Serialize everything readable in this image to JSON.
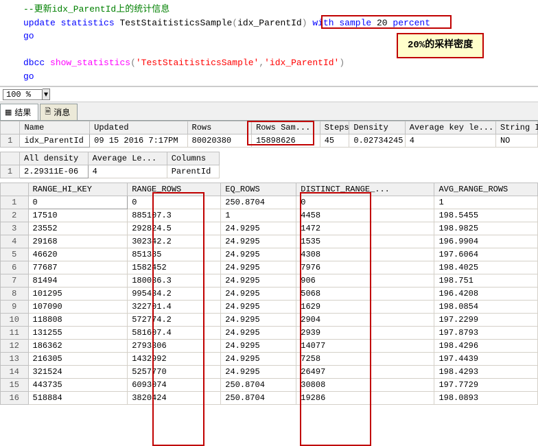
{
  "sql": {
    "comment": "--更新idx_ParentId上的统计信息",
    "update": "update",
    "statistics": "statistics",
    "tableref": "TestStaitisticsSample(idx_ParentId)",
    "lparen": "(",
    "rparen": ")",
    "table_name": "TestStaitisticsSample",
    "index_name": "idx_ParentId",
    "with": "with",
    "sample": "sample",
    "num": "20",
    "percent": "percent",
    "go1": "go",
    "dbcc": "dbcc",
    "show_stats": "show_statistics",
    "arg1": "'TestStaitisticsSample'",
    "comma": ",",
    "arg2": "'idx_ParentId'",
    "go2": "go"
  },
  "callout_text": "20%的采样密度",
  "zoom": "100 %",
  "tabs": {
    "results": "结果",
    "messages": "消息"
  },
  "grid1": {
    "headers": [
      "Name",
      "Updated",
      "Rows",
      "Rows Sam...",
      "Steps",
      "Density",
      "Average key le...",
      "String I"
    ],
    "rows": [
      {
        "n": "1",
        "cells": [
          "idx_ParentId",
          "09 15 2016  7:17PM",
          "80020380",
          "15898626",
          "45",
          "0.02734245",
          "4",
          "NO"
        ]
      }
    ]
  },
  "grid2": {
    "headers": [
      "All density",
      "Average Le...",
      "Columns"
    ],
    "rows": [
      {
        "n": "1",
        "cells": [
          "2.29311E-06",
          "4",
          "ParentId"
        ]
      }
    ]
  },
  "grid3": {
    "headers": [
      "RANGE_HI_KEY",
      "RANGE_ROWS",
      "EQ_ROWS",
      "DISTINCT_RANGE_...",
      "AVG_RANGE_ROWS"
    ],
    "rows": [
      {
        "n": "1",
        "cells": [
          "0",
          "0",
          "250.8704",
          "0",
          "1"
        ]
      },
      {
        "n": "2",
        "cells": [
          "17510",
          "885107.3",
          "1",
          "4458",
          "198.5455"
        ]
      },
      {
        "n": "3",
        "cells": [
          "23552",
          "292824.5",
          "24.9295",
          "1472",
          "198.9825"
        ]
      },
      {
        "n": "4",
        "cells": [
          "29168",
          "302342.2",
          "24.9295",
          "1535",
          "196.9904"
        ]
      },
      {
        "n": "5",
        "cells": [
          "46620",
          "851385",
          "24.9295",
          "4308",
          "197.6064"
        ]
      },
      {
        "n": "6",
        "cells": [
          "77687",
          "1582452",
          "24.9295",
          "7976",
          "198.4025"
        ]
      },
      {
        "n": "7",
        "cells": [
          "81494",
          "180036.3",
          "24.9295",
          "906",
          "198.751"
        ]
      },
      {
        "n": "8",
        "cells": [
          "101295",
          "995434.2",
          "24.9295",
          "5068",
          "196.4208"
        ]
      },
      {
        "n": "9",
        "cells": [
          "107090",
          "322701.4",
          "24.9295",
          "1629",
          "198.0854"
        ]
      },
      {
        "n": "10",
        "cells": [
          "118808",
          "572774.2",
          "24.9295",
          "2904",
          "197.2299"
        ]
      },
      {
        "n": "11",
        "cells": [
          "131255",
          "581607.4",
          "24.9295",
          "2939",
          "197.8793"
        ]
      },
      {
        "n": "12",
        "cells": [
          "186362",
          "2793306",
          "24.9295",
          "14077",
          "198.4296"
        ]
      },
      {
        "n": "13",
        "cells": [
          "216305",
          "1432992",
          "24.9295",
          "7258",
          "197.4439"
        ]
      },
      {
        "n": "14",
        "cells": [
          "321524",
          "5257770",
          "24.9295",
          "26497",
          "198.4293"
        ]
      },
      {
        "n": "15",
        "cells": [
          "443735",
          "6093074",
          "250.8704",
          "30808",
          "197.7729"
        ]
      },
      {
        "n": "16",
        "cells": [
          "518884",
          "3820424",
          "250.8704",
          "19286",
          "198.0893"
        ]
      }
    ]
  }
}
